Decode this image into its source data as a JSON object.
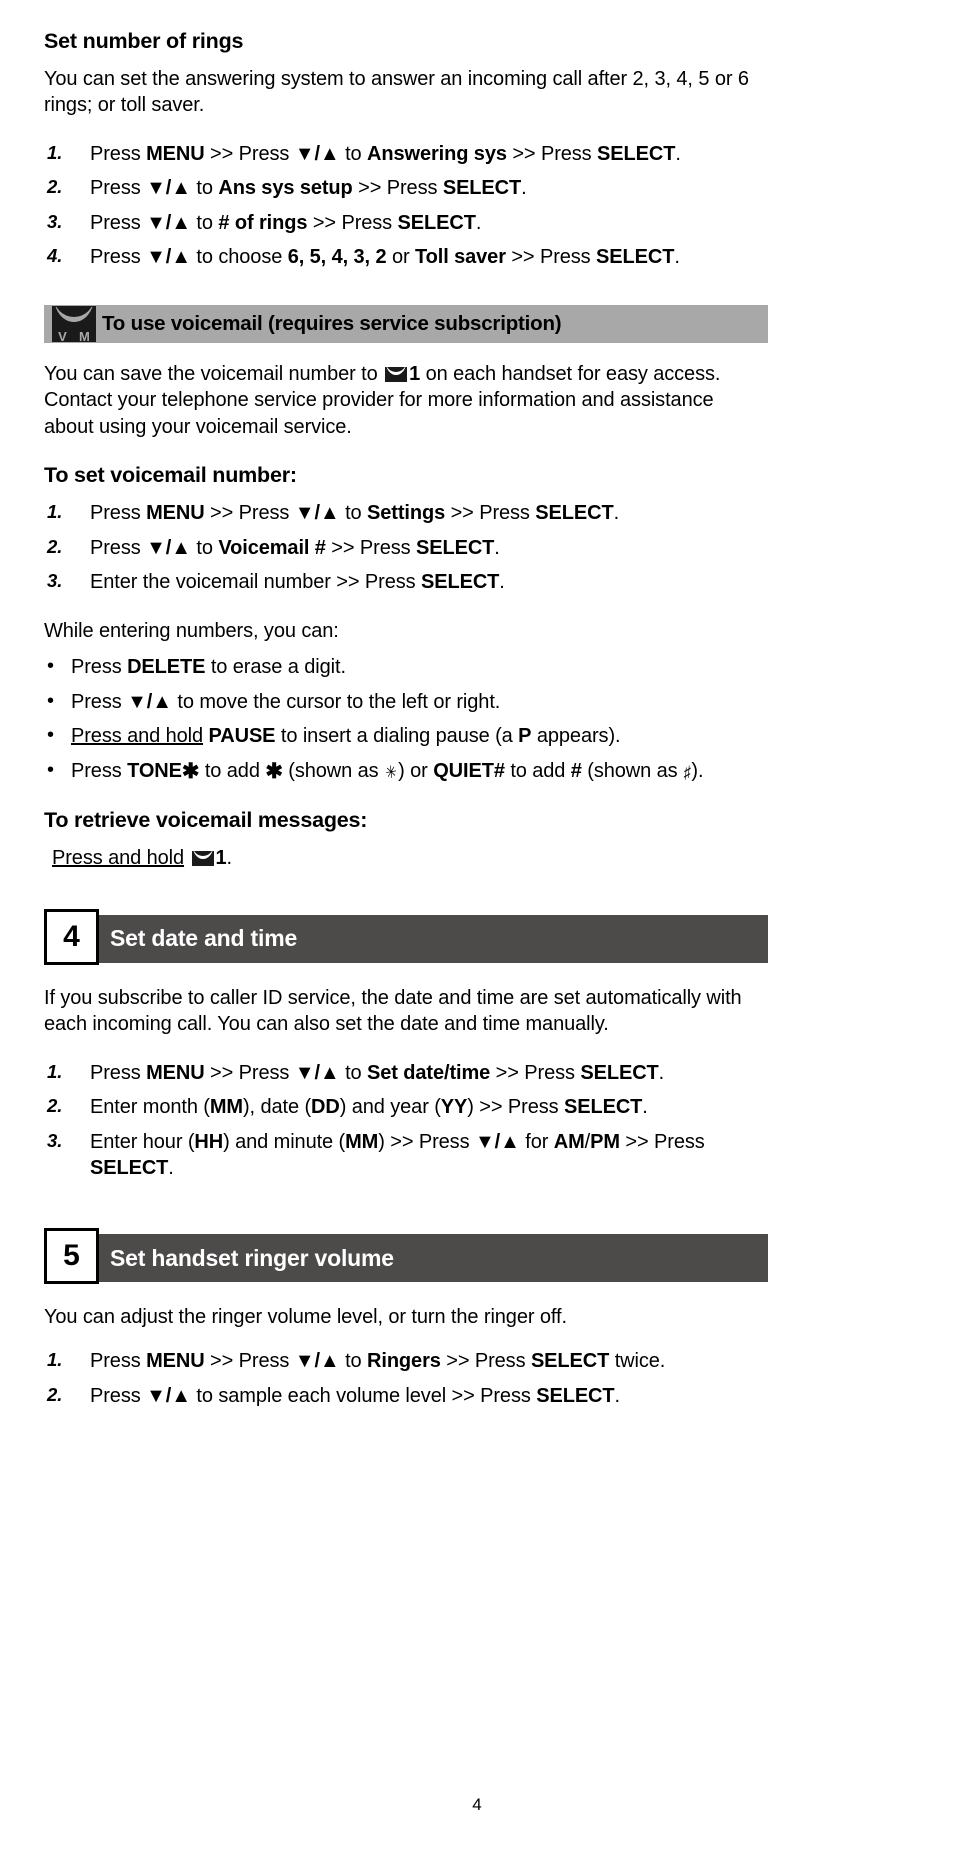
{
  "page": {
    "number": "4"
  },
  "rings_section": {
    "heading": "Set number of rings",
    "intro": "You can set the answering system to answer an incoming call after 2, 3, 4, 5 or 6 rings; or toll saver.",
    "steps": [
      {
        "num": "1.",
        "parts": [
          {
            "t": "Press ",
            "s": "normal"
          },
          {
            "t": "MENU",
            "s": "bold"
          },
          {
            "t": " >> Press ",
            "s": "normal"
          },
          {
            "t": "▼/▲",
            "s": "bold"
          },
          {
            "t": " to ",
            "s": "normal"
          },
          {
            "t": "Answering sys",
            "s": "bold"
          },
          {
            "t": " >> Press ",
            "s": "normal"
          },
          {
            "t": "SELECT",
            "s": "bold"
          },
          {
            "t": ".",
            "s": "normal"
          }
        ]
      },
      {
        "num": "2.",
        "parts": [
          {
            "t": "Press ",
            "s": "normal"
          },
          {
            "t": "▼/▲",
            "s": "bold"
          },
          {
            "t": " to ",
            "s": "normal"
          },
          {
            "t": "Ans sys setup",
            "s": "bold"
          },
          {
            "t": " >> Press ",
            "s": "normal"
          },
          {
            "t": "SELECT",
            "s": "bold"
          },
          {
            "t": ".",
            "s": "normal"
          }
        ]
      },
      {
        "num": "3.",
        "parts": [
          {
            "t": "Press ",
            "s": "normal"
          },
          {
            "t": "▼/▲",
            "s": "bold"
          },
          {
            "t": " to ",
            "s": "normal"
          },
          {
            "t": "# of rings",
            "s": "bold"
          },
          {
            "t": " >> Press ",
            "s": "normal"
          },
          {
            "t": "SELECT",
            "s": "bold"
          },
          {
            "t": ".",
            "s": "normal"
          }
        ]
      },
      {
        "num": "4.",
        "parts": [
          {
            "t": "Press ",
            "s": "normal"
          },
          {
            "t": "▼/▲",
            "s": "bold"
          },
          {
            "t": " to choose ",
            "s": "normal"
          },
          {
            "t": "6, 5, 4, 3, 2",
            "s": "bold"
          },
          {
            "t": " or ",
            "s": "normal"
          },
          {
            "t": "Toll saver",
            "s": "bold"
          },
          {
            "t": " >> Press ",
            "s": "normal"
          },
          {
            "t": "SELECT",
            "s": "bold"
          },
          {
            "t": ".",
            "s": "normal"
          }
        ]
      }
    ]
  },
  "voicemail_bar": {
    "icon": "voicemail-envelope-icon",
    "icon_letters": [
      "V",
      "M"
    ],
    "title": "To use voicemail (requires service subscription)",
    "background": "#a8a8a8"
  },
  "voicemail_section": {
    "intro_parts": [
      {
        "t": "You can save the voicemail number to ",
        "s": "normal"
      },
      {
        "t": "envelope-icon",
        "s": "icon"
      },
      {
        "t": "1",
        "s": "bold"
      },
      {
        "t": " on each handset for easy access. Contact your telephone service provider for more information and assistance about using your voicemail service.",
        "s": "normal"
      }
    ],
    "set_heading": "To set voicemail number:",
    "set_steps": [
      {
        "num": "1.",
        "parts": [
          {
            "t": "Press ",
            "s": "normal"
          },
          {
            "t": "MENU",
            "s": "bold"
          },
          {
            "t": " >> Press ",
            "s": "normal"
          },
          {
            "t": "▼/▲",
            "s": "bold"
          },
          {
            "t": " to ",
            "s": "normal"
          },
          {
            "t": "Settings",
            "s": "bold"
          },
          {
            "t": " >> Press ",
            "s": "normal"
          },
          {
            "t": "SELECT",
            "s": "bold"
          },
          {
            "t": ".",
            "s": "normal"
          }
        ]
      },
      {
        "num": "2.",
        "parts": [
          {
            "t": "Press ",
            "s": "normal"
          },
          {
            "t": "▼/▲",
            "s": "bold"
          },
          {
            "t": " to ",
            "s": "normal"
          },
          {
            "t": "Voicemail #",
            "s": "bold"
          },
          {
            "t": " >> Press ",
            "s": "normal"
          },
          {
            "t": "SELECT",
            "s": "bold"
          },
          {
            "t": ".",
            "s": "normal"
          }
        ]
      },
      {
        "num": "3.",
        "parts": [
          {
            "t": "Enter the voicemail number >> Press ",
            "s": "normal"
          },
          {
            "t": "SELECT",
            "s": "bold"
          },
          {
            "t": ".",
            "s": "normal"
          }
        ]
      }
    ],
    "while_entering": "While entering numbers, you can:",
    "bullets": [
      {
        "parts": [
          {
            "t": "Press ",
            "s": "normal"
          },
          {
            "t": "DELETE",
            "s": "bold"
          },
          {
            "t": " to erase a digit.",
            "s": "normal"
          }
        ]
      },
      {
        "parts": [
          {
            "t": "Press ",
            "s": "normal"
          },
          {
            "t": "▼/▲",
            "s": "bold"
          },
          {
            "t": " to move the cursor to the left or right.",
            "s": "normal"
          }
        ]
      },
      {
        "parts": [
          {
            "t": "Press and hold",
            "s": "underline"
          },
          {
            "t": " ",
            "s": "normal"
          },
          {
            "t": "PAUSE",
            "s": "bold"
          },
          {
            "t": " to insert a dialing pause (a ",
            "s": "normal"
          },
          {
            "t": "P",
            "s": "bold"
          },
          {
            "t": " appears).",
            "s": "normal"
          }
        ]
      },
      {
        "parts": [
          {
            "t": "Press ",
            "s": "normal"
          },
          {
            "t": "TONE",
            "s": "bold"
          },
          {
            "t": "star-glyph",
            "s": "star"
          },
          {
            "t": " to add ",
            "s": "normal"
          },
          {
            "t": "star-glyph",
            "s": "star"
          },
          {
            "t": " (shown as ",
            "s": "normal"
          },
          {
            "t": "lcd-star-glyph",
            "s": "lcdstar"
          },
          {
            "t": ") or ",
            "s": "normal"
          },
          {
            "t": "QUIET",
            "s": "bold"
          },
          {
            "t": "#",
            "s": "boldhash"
          },
          {
            "t": " to add ",
            "s": "normal"
          },
          {
            "t": "#",
            "s": "boldhash"
          },
          {
            "t": " (shown as ",
            "s": "normal"
          },
          {
            "t": "lcd-hash-glyph",
            "s": "lcdhash"
          },
          {
            "t": ").",
            "s": "normal"
          }
        ]
      }
    ],
    "retrieve_heading": "To retrieve voicemail messages:",
    "retrieve_parts": [
      {
        "t": "Press and hold",
        "s": "underline"
      },
      {
        "t": " ",
        "s": "normal"
      },
      {
        "t": "envelope-icon",
        "s": "icon"
      },
      {
        "t": "1",
        "s": "bold"
      },
      {
        "t": ".",
        "s": "normal"
      }
    ]
  },
  "section4": {
    "number": "4",
    "title": "Set date and time",
    "background": "#4d4a4a",
    "intro": "If you subscribe to caller ID service, the date and time are set automatically with each incoming call. You can also set the date and time manually.",
    "steps": [
      {
        "num": "1.",
        "parts": [
          {
            "t": "Press ",
            "s": "normal"
          },
          {
            "t": "MENU",
            "s": "bold"
          },
          {
            "t": " >> Press ",
            "s": "normal"
          },
          {
            "t": "▼/▲",
            "s": "bold"
          },
          {
            "t": " to ",
            "s": "normal"
          },
          {
            "t": "Set date/time",
            "s": "bold"
          },
          {
            "t": " >> Press ",
            "s": "normal"
          },
          {
            "t": "SELECT",
            "s": "bold"
          },
          {
            "t": ".",
            "s": "normal"
          }
        ]
      },
      {
        "num": "2.",
        "parts": [
          {
            "t": "Enter month (",
            "s": "normal"
          },
          {
            "t": "MM",
            "s": "bold"
          },
          {
            "t": "), date (",
            "s": "normal"
          },
          {
            "t": "DD",
            "s": "bold"
          },
          {
            "t": ") and year (",
            "s": "normal"
          },
          {
            "t": "YY",
            "s": "bold"
          },
          {
            "t": ") >> Press ",
            "s": "normal"
          },
          {
            "t": "SELECT",
            "s": "bold"
          },
          {
            "t": ".",
            "s": "normal"
          }
        ]
      },
      {
        "num": "3.",
        "parts": [
          {
            "t": "Enter hour (",
            "s": "normal"
          },
          {
            "t": "HH",
            "s": "bold"
          },
          {
            "t": ") and minute (",
            "s": "normal"
          },
          {
            "t": "MM",
            "s": "bold"
          },
          {
            "t": ") >> Press ",
            "s": "normal"
          },
          {
            "t": "▼/▲",
            "s": "bold"
          },
          {
            "t": " for ",
            "s": "normal"
          },
          {
            "t": "AM",
            "s": "bold"
          },
          {
            "t": "/",
            "s": "normal"
          },
          {
            "t": "PM",
            "s": "bold"
          },
          {
            "t": "\n>> Press ",
            "s": "normal"
          },
          {
            "t": "SELECT",
            "s": "bold"
          },
          {
            "t": ".",
            "s": "normal"
          }
        ]
      }
    ]
  },
  "section5": {
    "number": "5",
    "title": "Set handset ringer volume",
    "background": "#4d4a4a",
    "intro": "You can adjust the ringer volume level, or turn the ringer off.",
    "steps": [
      {
        "num": "1.",
        "parts": [
          {
            "t": "Press ",
            "s": "normal"
          },
          {
            "t": "MENU",
            "s": "bold"
          },
          {
            "t": " >> Press ",
            "s": "normal"
          },
          {
            "t": "▼/▲",
            "s": "bold"
          },
          {
            "t": " to ",
            "s": "normal"
          },
          {
            "t": "Ringers",
            "s": "bold"
          },
          {
            "t": " >> Press ",
            "s": "normal"
          },
          {
            "t": "SELECT",
            "s": "bold"
          },
          {
            "t": " twice.",
            "s": "normal"
          }
        ]
      },
      {
        "num": "2.",
        "parts": [
          {
            "t": "Press ",
            "s": "normal"
          },
          {
            "t": "▼/▲",
            "s": "bold"
          },
          {
            "t": " to sample each volume level >> Press ",
            "s": "normal"
          },
          {
            "t": "SELECT",
            "s": "bold"
          },
          {
            "t": ".",
            "s": "normal"
          }
        ]
      }
    ]
  }
}
